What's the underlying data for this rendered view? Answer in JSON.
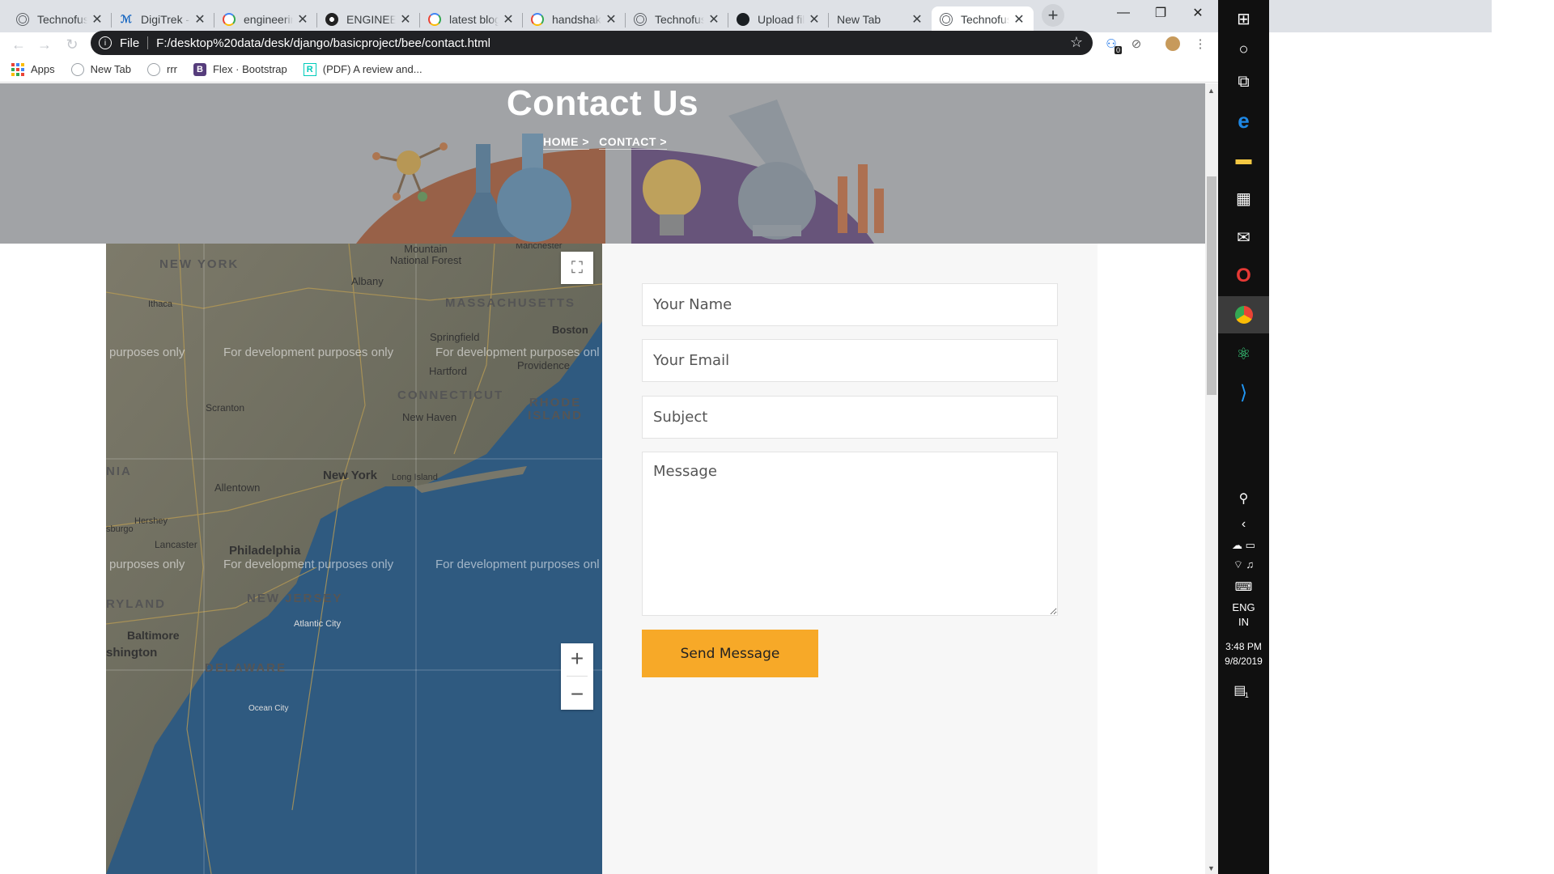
{
  "browser": {
    "tabs": [
      {
        "title": "Technofusio",
        "favicon": "globe-icon"
      },
      {
        "title": "DigiTrek - A",
        "favicon": "digitrek-icon"
      },
      {
        "title": "engineering",
        "favicon": "google-icon"
      },
      {
        "title": "ENGINEERI",
        "favicon": "engineering-icon"
      },
      {
        "title": "latest blog",
        "favicon": "google-icon"
      },
      {
        "title": "handshake",
        "favicon": "google-icon"
      },
      {
        "title": "Technofusio",
        "favicon": "globe-icon"
      },
      {
        "title": "Upload file",
        "favicon": "github-icon"
      },
      {
        "title": "New Tab",
        "favicon": ""
      },
      {
        "title": "Technofusio",
        "favicon": "globe-icon"
      }
    ],
    "active_tab": 9,
    "address": {
      "scheme_label": "File",
      "url": "F:/desktop%20data/desk/django/basicproject/bee/contact.html"
    },
    "extension_badge": "0",
    "bookmarks": [
      {
        "label": "Apps",
        "icon": "apps-grid-icon"
      },
      {
        "label": "New Tab",
        "icon": "globe-icon"
      },
      {
        "label": "rrr",
        "icon": "globe-icon"
      },
      {
        "label": "Flex · Bootstrap",
        "icon": "bootstrap-icon"
      },
      {
        "label": "(PDF) A review and...",
        "icon": "researchgate-icon"
      }
    ]
  },
  "page": {
    "hero": {
      "title": "Contact Us",
      "breadcrumb": [
        "HOME >",
        "CONTACT >"
      ]
    },
    "map": {
      "watermark": "For development purposes only",
      "watermark_partial_left": "purposes only",
      "watermark_partial_right": "For development purposes onl",
      "states": [
        "NEW YORK",
        "MASSACHUSETTS",
        "CONNECTICUT",
        "RHODE ISLAND",
        "NEW JERSEY",
        "RYLAND",
        "DELAWARE",
        "NIA"
      ],
      "places": [
        "Mountain National Forest",
        "Manchester",
        "Albany",
        "Ithaca",
        "Boston",
        "Springfield",
        "Hartford",
        "Providence",
        "Scranton",
        "New Haven",
        "New York",
        "Long Island",
        "Allentown",
        "Hershey",
        "Lancaster",
        "sburgo",
        "Philadelphia",
        "Atlantic City",
        "Baltimore",
        "shington",
        "Ocean City"
      ],
      "fullscreen_icon": "fullscreen-icon",
      "zoom_in_icon": "zoom-in-icon",
      "zoom_out_icon": "zoom-out-icon"
    },
    "form": {
      "name_placeholder": "Your Name",
      "email_placeholder": "Your Email",
      "subject_placeholder": "Subject",
      "message_placeholder": "Message",
      "send_label": "Send Message"
    }
  },
  "taskbar": {
    "language": "ENG",
    "region": "IN",
    "time": "3:48 PM",
    "date": "9/8/2019",
    "notification_count": "1"
  },
  "colors": {
    "accent_button": "#f7a928",
    "omnibox": "#202124",
    "map_water": "#2f5a80",
    "taskbar": "#101010"
  }
}
